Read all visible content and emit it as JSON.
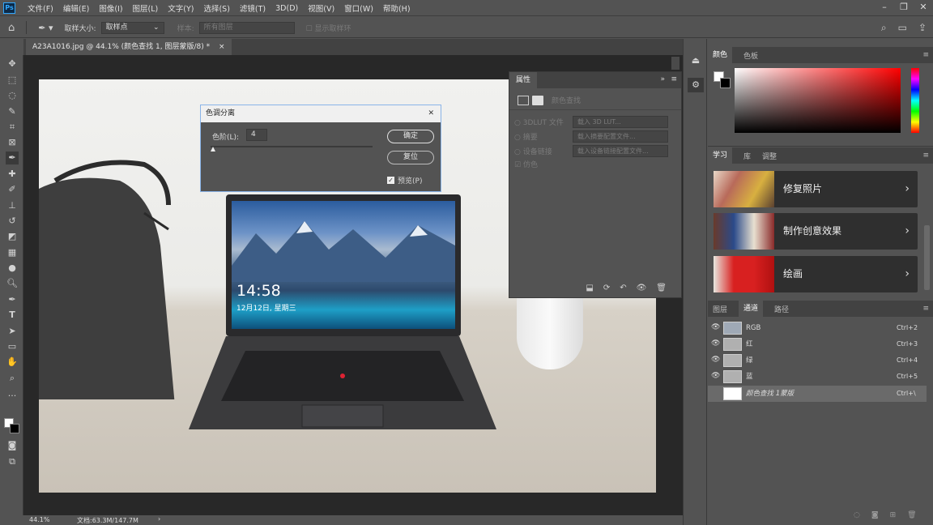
{
  "menubar": {
    "logo": "Ps",
    "items": [
      "文件(F)",
      "编辑(E)",
      "图像(I)",
      "图层(L)",
      "文字(Y)",
      "选择(S)",
      "滤镜(T)",
      "3D(D)",
      "视图(V)",
      "窗口(W)",
      "帮助(H)"
    ]
  },
  "options": {
    "sample_size_label": "取样大小:",
    "sample_size_value": "取样点",
    "sample_label": "样本:",
    "sample_value": "所有图层",
    "show_ring": "显示取样环"
  },
  "document": {
    "tab_title": "A23A1016.jpg @ 44.1% (颜色查找 1, 图层蒙版/8) *",
    "close": "×"
  },
  "status": {
    "zoom": "44.1%",
    "doc_info": "文档:63.3M/147.7M",
    "arrow": "›"
  },
  "laptop_screen": {
    "time": "14:58",
    "date": "12月12日, 星期三"
  },
  "dialog": {
    "title": "色调分离",
    "close": "✕",
    "levels_label": "色阶(L):",
    "levels_value": "4",
    "ok": "确定",
    "reset": "复位",
    "preview_label": "预览(P)",
    "preview_checked": true
  },
  "properties": {
    "title": "属性",
    "collapse": "»",
    "subtitle": "颜色查找",
    "rows": [
      {
        "label": "3DLUT 文件",
        "value": "载入 3D LUT..."
      },
      {
        "label": "摘要",
        "value": "载入摘要配置文件..."
      },
      {
        "label": "设备链接",
        "value": "载入设备链接配置文件..."
      },
      {
        "label": "仿色",
        "value": ""
      }
    ]
  },
  "color_panel": {
    "tabs": [
      "颜色",
      "色板"
    ]
  },
  "learn_panel": {
    "tabs": [
      "学习",
      "库",
      "调整"
    ],
    "items": [
      {
        "label": "修复照片"
      },
      {
        "label": "制作创意效果"
      },
      {
        "label": "绘画"
      }
    ]
  },
  "channels_panel": {
    "tabs": [
      "图层",
      "通道",
      "路径"
    ],
    "rows": [
      {
        "name": "RGB",
        "shortcut": "Ctrl+2"
      },
      {
        "name": "红",
        "shortcut": "Ctrl+3"
      },
      {
        "name": "绿",
        "shortcut": "Ctrl+4"
      },
      {
        "name": "蓝",
        "shortcut": "Ctrl+5"
      },
      {
        "name": "颜色查找 1蒙版",
        "shortcut": "Ctrl+\\"
      }
    ]
  },
  "colors": {
    "accent": "#31a8ff",
    "ui_bg": "#535353",
    "canvas_bg": "#282828"
  }
}
